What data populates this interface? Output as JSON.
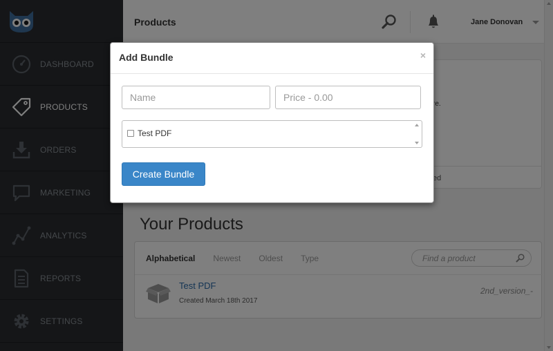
{
  "sidebar": {
    "logo_icon": "owl-logo-icon",
    "items": [
      {
        "label": "DASHBOARD",
        "icon": "speedometer-icon",
        "active": false
      },
      {
        "label": "PRODUCTS",
        "icon": "tag-icon",
        "active": true
      },
      {
        "label": "ORDERS",
        "icon": "download-tray-icon",
        "active": false
      },
      {
        "label": "MARKETING",
        "icon": "speech-bubble-icon",
        "active": false
      },
      {
        "label": "ANALYTICS",
        "icon": "line-graph-icon",
        "active": false
      },
      {
        "label": "REPORTS",
        "icon": "document-icon",
        "active": false
      },
      {
        "label": "SETTINGS",
        "icon": "gear-icon",
        "active": false
      }
    ]
  },
  "header": {
    "title": "Products",
    "user_name": "Jane Donovan"
  },
  "background": {
    "snippet_1": "re.",
    "snippet_2": "ed"
  },
  "products": {
    "heading": "Your Products",
    "filters": [
      {
        "label": "Alphabetical",
        "active": true
      },
      {
        "label": "Newest",
        "active": false
      },
      {
        "label": "Oldest",
        "active": false
      },
      {
        "label": "Type",
        "active": false
      }
    ],
    "search_placeholder": "Find a product",
    "items": [
      {
        "name": "Test PDF",
        "created": "Created March 18th 2017",
        "version": "2nd_version_-"
      }
    ]
  },
  "modal": {
    "title": "Add Bundle",
    "close_label": "×",
    "name_placeholder": "Name",
    "price_placeholder": "Price - 0.00",
    "list_items": [
      {
        "label": "Test PDF",
        "checked": false
      }
    ],
    "submit_label": "Create Bundle"
  },
  "colors": {
    "sidebar_bg": "#2a2d31",
    "primary_button": "#3a86c8",
    "link": "#2a6aa8"
  }
}
